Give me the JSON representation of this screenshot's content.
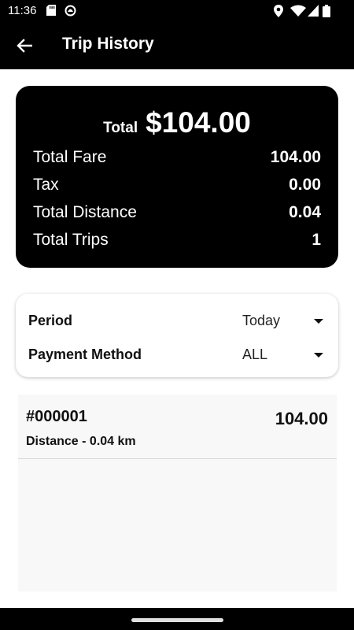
{
  "status_bar": {
    "time": "11:36",
    "icons": [
      "sd-card-icon",
      "notification-icon",
      "location-icon",
      "wifi-icon",
      "signal-icon",
      "battery-icon"
    ]
  },
  "app_bar": {
    "title": "Trip History",
    "back_icon": "arrow-left-icon"
  },
  "summary": {
    "total_label": "Total",
    "total_amount": "$104.00",
    "rows": [
      {
        "label": "Total Fare",
        "value": "104.00"
      },
      {
        "label": "Tax",
        "value": "0.00"
      },
      {
        "label": "Total Distance",
        "value": "0.04"
      },
      {
        "label": "Total Trips",
        "value": "1"
      }
    ]
  },
  "filters": {
    "period": {
      "label": "Period",
      "value": "Today"
    },
    "payment_method": {
      "label": "Payment Method",
      "value": "ALL"
    }
  },
  "trips": [
    {
      "id": "#000001",
      "distance": "Distance - 0.04 km",
      "amount": "104.00"
    }
  ],
  "colors": {
    "bar_bg": "#000000",
    "card_bg": "#000000",
    "list_bg": "#f8f8f8",
    "text_light": "#ffffff",
    "text_dark": "#111111"
  }
}
